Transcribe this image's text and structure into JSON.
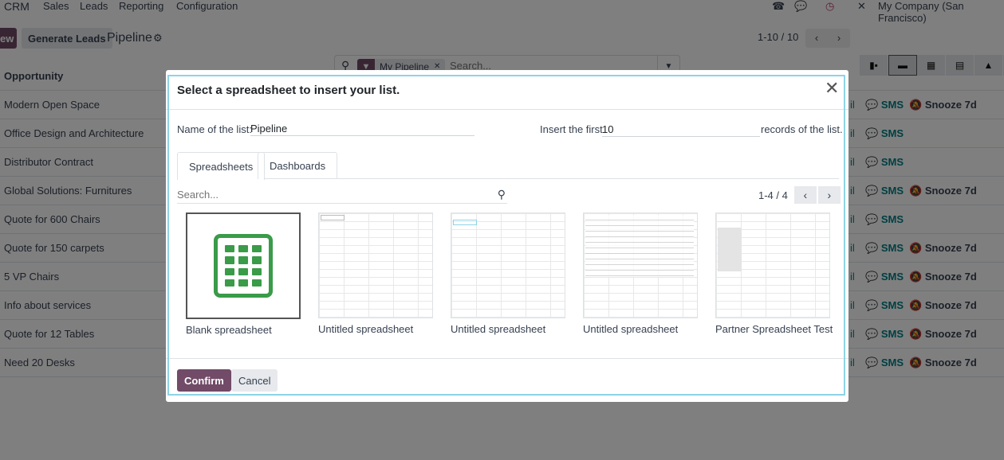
{
  "nav": {
    "app": "CRM",
    "menus": [
      "Sales",
      "Leads",
      "Reporting",
      "Configuration"
    ],
    "company": "My Company (San Francisco)"
  },
  "control": {
    "new_label": "ew",
    "generate_label": "Generate Leads",
    "title": "Pipeline",
    "facet": "My Pipeline",
    "search_placeholder": "Search...",
    "pager": "1-10 / 10"
  },
  "list": {
    "header": "Opportunity",
    "email_label": "il",
    "sms_label": "SMS",
    "snooze_label": "Snooze 7d",
    "rows": [
      {
        "name": "Modern Open Space",
        "snooze": true
      },
      {
        "name": "Office Design and Architecture",
        "snooze": false
      },
      {
        "name": "Distributor Contract",
        "snooze": false
      },
      {
        "name": "Global Solutions: Furnitures",
        "snooze": true
      },
      {
        "name": "Quote for 600 Chairs",
        "snooze": false
      },
      {
        "name": "Quote for 150 carpets",
        "snooze": true
      },
      {
        "name": "5 VP Chairs",
        "snooze": true
      },
      {
        "name": "Info about services",
        "snooze": true
      },
      {
        "name": "Quote for 12 Tables",
        "snooze": true
      },
      {
        "name": "Need 20 Desks",
        "snooze": true
      }
    ]
  },
  "dialog": {
    "title": "Select a spreadsheet to insert your list.",
    "name_label": "Name of the list:",
    "name_value": "Pipeline",
    "insert_label": "Insert the first",
    "insert_value": "10",
    "records_label": "records of the list.",
    "tabs": [
      "Spreadsheets",
      "Dashboards"
    ],
    "search_placeholder": "Search...",
    "pager": "1-4 / 4",
    "cards": [
      "Blank spreadsheet",
      "Untitled spreadsheet",
      "Untitled spreadsheet",
      "Untitled spreadsheet",
      "Partner Spreadsheet Test"
    ],
    "confirm": "Confirm",
    "cancel": "Cancel"
  },
  "colors": {
    "brand": "#714b67",
    "accent": "#017e84",
    "spreadsheet_green": "#3a9b48"
  }
}
